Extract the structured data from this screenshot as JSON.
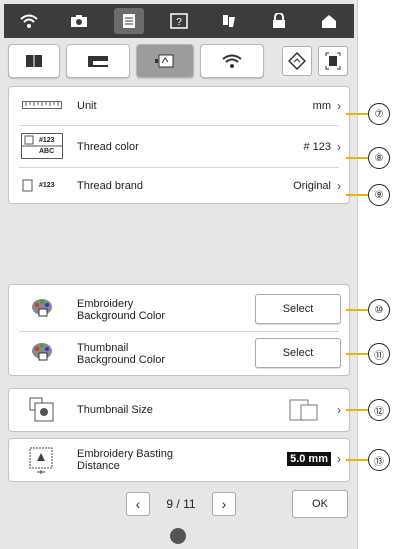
{
  "colors": {
    "accent": "#e5b500",
    "bar": "#3c3c3c"
  },
  "topbar_icons": [
    "wifi-icon",
    "camera-icon",
    "document-icon",
    "help-icon",
    "thread-icon",
    "lock-icon",
    "home-icon"
  ],
  "tabs": [
    "book-icon",
    "sewing-machine-icon",
    "embroidery-frame-icon",
    "wifi-icon"
  ],
  "tab_right_icons": [
    "update-icon",
    "fullscreen-icon"
  ],
  "settings": {
    "unit": {
      "label": "Unit",
      "value": "mm",
      "callout": "⑦"
    },
    "thread_color": {
      "label": "Thread color",
      "value": "# 123",
      "callout": "⑧",
      "icon_text_top": "#123",
      "icon_text_bottom": "ABC"
    },
    "thread_brand": {
      "label": "Thread brand",
      "value": "Original",
      "callout": "⑨",
      "icon_text": "#123"
    },
    "emb_bg": {
      "label_line1": "Embroidery",
      "label_line2": "Background Color",
      "button": "Select",
      "callout": "⑩"
    },
    "thumb_bg": {
      "label_line1": "Thumbnail",
      "label_line2": "Background Color",
      "button": "Select",
      "callout": "⑪"
    },
    "thumb_size": {
      "label": "Thumbnail Size",
      "callout": "⑫"
    },
    "basting": {
      "label_line1": "Embroidery Basting",
      "label_line2": "Distance",
      "value": "5.0 mm",
      "callout": "⑬"
    }
  },
  "pagination": {
    "text": "9 / 11",
    "ok": "OK"
  }
}
